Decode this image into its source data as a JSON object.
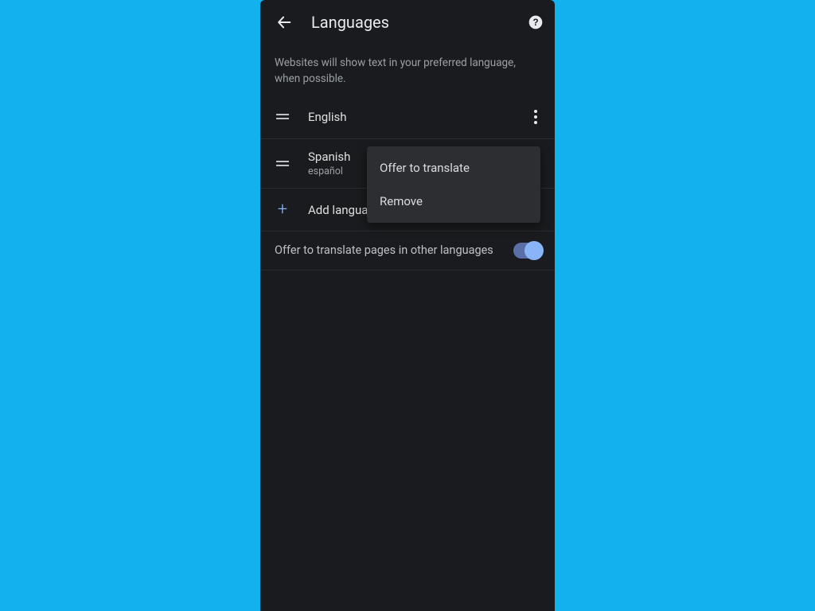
{
  "header": {
    "title": "Languages"
  },
  "subtitle": "Websites will show text in your preferred language, when possible.",
  "languages": [
    {
      "name": "English",
      "subname": ""
    },
    {
      "name": "Spanish",
      "subname": "español"
    }
  ],
  "add_label": "Add language",
  "setting": {
    "label": "Offer to translate pages in other languages",
    "enabled": true
  },
  "popup": {
    "items": [
      "Offer to translate",
      "Remove"
    ]
  }
}
